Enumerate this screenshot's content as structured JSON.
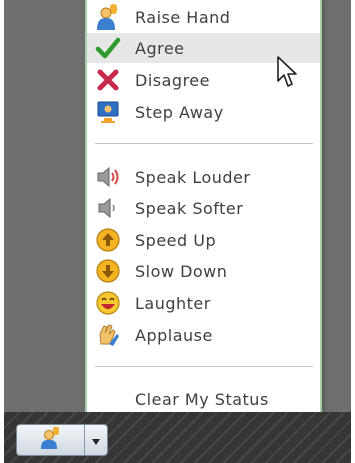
{
  "menu": {
    "items": [
      {
        "label": "Raise Hand",
        "icon": "raise-hand-icon"
      },
      {
        "label": "Agree",
        "icon": "checkmark-icon"
      },
      {
        "label": "Disagree",
        "icon": "x-mark-icon"
      },
      {
        "label": "Step Away",
        "icon": "step-away-icon"
      },
      {
        "label": "Speak Louder",
        "icon": "speaker-loud-icon"
      },
      {
        "label": "Speak Softer",
        "icon": "speaker-soft-icon"
      },
      {
        "label": "Speed Up",
        "icon": "speed-up-icon"
      },
      {
        "label": "Slow Down",
        "icon": "slow-down-icon"
      },
      {
        "label": "Laughter",
        "icon": "laughter-icon"
      },
      {
        "label": "Applause",
        "icon": "applause-icon"
      },
      {
        "label": "Clear My Status"
      }
    ],
    "hovered_item": "Agree"
  },
  "taskbar": {
    "status_button_icon": "person-status-icon",
    "dropdown_icon": "triangle-down-icon"
  },
  "colors": {
    "menu_border": "#a9cfa9",
    "hover_background": "#e7e7e7",
    "text": "#404040"
  }
}
